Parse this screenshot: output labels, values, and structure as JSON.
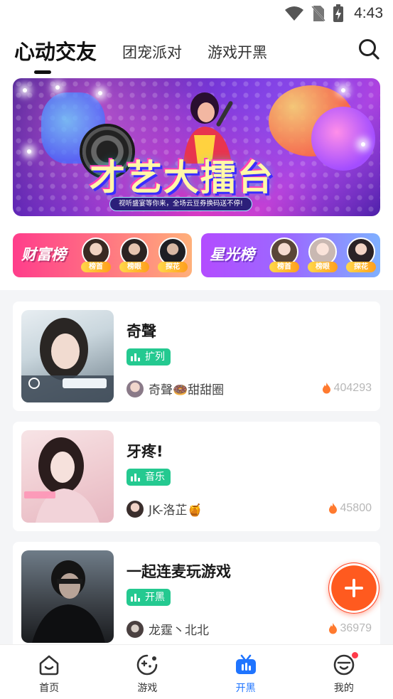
{
  "status_bar": {
    "time": "4:43",
    "icons": [
      "wifi-icon",
      "no-sim-icon",
      "battery-charging-icon"
    ]
  },
  "top_tabs": [
    {
      "label": "心动交友",
      "active": true
    },
    {
      "label": "团宠派对",
      "active": false
    },
    {
      "label": "游戏开黑",
      "active": false
    }
  ],
  "search": {
    "icon": "search-icon"
  },
  "banner": {
    "title": "才艺大擂台",
    "subtitle": "视听盛宴等你来，全场云豆券换码送不停!"
  },
  "rank_cards": [
    {
      "title": "财富榜",
      "badges": [
        "榜首",
        "榜眼",
        "探花"
      ]
    },
    {
      "title": "星光榜",
      "badges": [
        "榜首",
        "榜眼",
        "探花"
      ]
    }
  ],
  "rooms": [
    {
      "title": "奇聲",
      "tag": "扩列",
      "host": "奇聲🍩甜甜圈",
      "heat": "404293",
      "tag_color": "#24c990"
    },
    {
      "title": "牙疼!",
      "tag": "音乐",
      "host": "JK-洛芷🍯",
      "heat": "45800",
      "tag_color": "#24c990"
    },
    {
      "title": "一起连麦玩游戏",
      "tag": "开黑",
      "host": "龙霆丶北北",
      "heat": "36979",
      "tag_color": "#24c990"
    }
  ],
  "bottom_nav": [
    {
      "label": "首页",
      "icon": "home-icon",
      "active": false
    },
    {
      "label": "游戏",
      "icon": "game-icon",
      "active": false
    },
    {
      "label": "开黑",
      "icon": "voice-room-icon",
      "active": true
    },
    {
      "label": "我的",
      "icon": "profile-icon",
      "active": false,
      "has_dot": true
    }
  ],
  "colors": {
    "accent": "#1f74ff",
    "tag_green": "#24c990",
    "fab_orange": "#ff5a1f",
    "heat_orange": "#ff7a2f"
  }
}
